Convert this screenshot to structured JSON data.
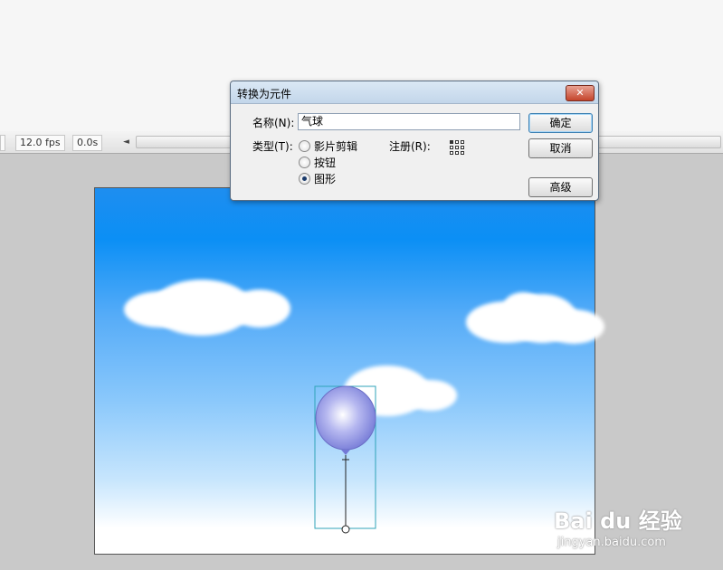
{
  "timeline": {
    "fps": "12.0 fps",
    "time": "0.0s",
    "arrow": "◄"
  },
  "dialog": {
    "title": "转换为元件",
    "close": "✕",
    "name_label": "名称(N):",
    "name_value": "气球",
    "type_label": "类型(T):",
    "types": [
      "影片剪辑",
      "按钮",
      "图形"
    ],
    "selected_type": "图形",
    "registration_label": "注册(R):",
    "registration_point": "top-left",
    "buttons": {
      "ok": "确定",
      "cancel": "取消",
      "advanced": "高级"
    }
  },
  "colors": {
    "sky_top": "#0b8ff5",
    "balloon": "#8a8ee0",
    "selection": "#2fa3b8"
  },
  "watermark": {
    "brand": "Bai du 经验",
    "url": "jingyan.baidu.com"
  }
}
